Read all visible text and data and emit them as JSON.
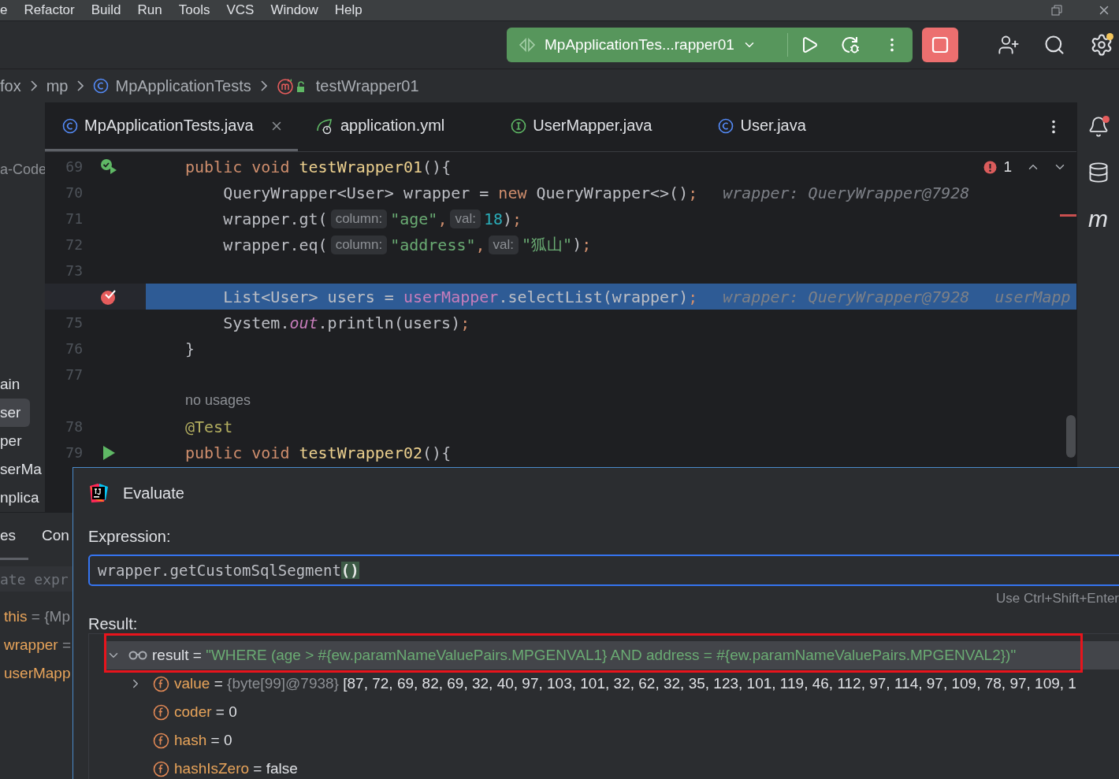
{
  "menu_bar": {
    "items": [
      "e",
      "Refactor",
      "Build",
      "Run",
      "Tools",
      "VCS",
      "Window",
      "Help"
    ]
  },
  "toolbar": {
    "run_configuration": "MpApplicationTes...rapper01"
  },
  "breadcrumbs": [
    {
      "label": "fox",
      "kind": "folder"
    },
    {
      "label": "mp",
      "kind": "folder"
    },
    {
      "label": "MpApplicationTests",
      "kind": "class"
    },
    {
      "label": "testWrapper01",
      "kind": "method"
    }
  ],
  "project_tree": {
    "root_label": "a-Code",
    "items": [
      {
        "label": "ain",
        "selected": false
      },
      {
        "label": "ser",
        "selected": true
      },
      {
        "label": "per",
        "selected": false
      },
      {
        "label": "serMa",
        "selected": false
      },
      {
        "label": "nplica",
        "selected": false
      }
    ]
  },
  "editor_tabs": [
    {
      "label": "MpApplicationTests.java",
      "kind": "class",
      "selected": true
    },
    {
      "label": "application.yml",
      "kind": "yaml",
      "selected": false
    },
    {
      "label": "UserMapper.java",
      "kind": "interface",
      "selected": false
    },
    {
      "label": "User.java",
      "kind": "class",
      "selected": false
    }
  ],
  "problems": {
    "count": "1"
  },
  "editor": {
    "lines": [
      {
        "kind": "code",
        "number": "69",
        "gutter_icon": {
          "kind": "run-passed"
        },
        "current": false,
        "tokens": [
          {
            "kind": "keyword",
            "text": "public void "
          },
          {
            "kind": "method",
            "text": "testWrapper01"
          },
          {
            "kind": "plain",
            "text": "(){"
          }
        ]
      },
      {
        "kind": "code",
        "number": "70",
        "current": false,
        "tokens": [
          {
            "kind": "plain",
            "text": "    QueryWrapper<User> wrapper = "
          },
          {
            "kind": "keyword",
            "text": "new "
          },
          {
            "kind": "plain",
            "text": "QueryWrapper<>()"
          },
          {
            "kind": "punct",
            "text": ";"
          },
          {
            "kind": "debug",
            "text": "wrapper: QueryWrapper@7928"
          }
        ]
      },
      {
        "kind": "code",
        "number": "71",
        "current": false,
        "tokens": [
          {
            "kind": "plain",
            "text": "    wrapper.gt("
          },
          {
            "kind": "hint",
            "text": "column:"
          },
          {
            "kind": "string",
            "text": "\"age\""
          },
          {
            "kind": "punct",
            "text": ","
          },
          {
            "kind": "hint",
            "text": "val:"
          },
          {
            "kind": "number",
            "text": "18"
          },
          {
            "kind": "plain",
            "text": ")"
          },
          {
            "kind": "punct",
            "text": ";"
          }
        ]
      },
      {
        "kind": "code",
        "number": "72",
        "current": false,
        "tokens": [
          {
            "kind": "plain",
            "text": "    wrapper.eq("
          },
          {
            "kind": "hint",
            "text": "column:"
          },
          {
            "kind": "string",
            "text": "\"address\""
          },
          {
            "kind": "punct",
            "text": ","
          },
          {
            "kind": "hint",
            "text": "val:"
          },
          {
            "kind": "string",
            "text": "\"狐山\""
          },
          {
            "kind": "plain",
            "text": ")"
          },
          {
            "kind": "punct",
            "text": ";"
          }
        ]
      },
      {
        "kind": "code",
        "number": "73",
        "current": false
      },
      {
        "kind": "code",
        "gutter_icon": {
          "kind": "breakpoint"
        },
        "current": true,
        "tokens": [
          {
            "kind": "plain",
            "text": "    List<User> users = "
          },
          {
            "kind": "field",
            "text": "userMapper"
          },
          {
            "kind": "plain",
            "text": ".selectList(wrapper)"
          },
          {
            "kind": "punct",
            "text": ";"
          },
          {
            "kind": "debug",
            "text": "wrapper: QueryWrapper@7928"
          },
          {
            "kind": "debug",
            "text": "userMapp"
          }
        ]
      },
      {
        "kind": "code",
        "number": "75",
        "current": false,
        "tokens": [
          {
            "kind": "plain",
            "text": "    System."
          },
          {
            "kind": "static",
            "text": "out"
          },
          {
            "kind": "plain",
            "text": ".println(users)"
          },
          {
            "kind": "punct",
            "text": ";"
          }
        ]
      },
      {
        "kind": "code",
        "number": "76",
        "current": false,
        "tokens": [
          {
            "kind": "plain",
            "text": "}"
          }
        ]
      },
      {
        "kind": "code",
        "number": "77",
        "current": false
      },
      {
        "kind": "usages",
        "text": "no usages"
      },
      {
        "kind": "code",
        "number": "78",
        "current": false,
        "tokens": [
          {
            "kind": "annotation",
            "text": "@Test"
          }
        ]
      },
      {
        "kind": "code",
        "number": "79",
        "gutter_icon": {
          "kind": "run"
        },
        "current": false,
        "tokens": [
          {
            "kind": "keyword",
            "text": "public void "
          },
          {
            "kind": "method",
            "text": "testWrapper02"
          },
          {
            "kind": "plain",
            "text": "(){"
          }
        ]
      }
    ]
  },
  "right_toolbar": {
    "plugin_letter": "m"
  },
  "debug_panel": {
    "tabs": [
      {
        "label": "es",
        "selected": true
      },
      {
        "label": "Con",
        "selected": false
      }
    ],
    "expression_field": {
      "placeholder": "ate expr"
    },
    "variables": [
      {
        "name": "this",
        "value": "= {Mp"
      },
      {
        "name": "wrapper",
        "value": "="
      },
      {
        "name": "userMapp"
      }
    ]
  },
  "evaluate_dialog": {
    "title": "Evaluate",
    "expression_label": "Expression:",
    "expression": [
      {
        "text": "wrapper.getCustomSqlSegment",
        "matched": false
      },
      {
        "text": "()",
        "matched": true
      }
    ],
    "hint": "Use Ctrl+Shift+Enter",
    "result_label": "Result:",
    "result_tree": [
      {
        "kind": "watch",
        "name": "result",
        "op": "=",
        "value": {
          "kind": "string",
          "text": "\"WHERE (age > #{ew.paramNameValuePairs.MPGENVAL1} AND address = #{ew.paramNameValuePairs.MPGENVAL2})\""
        },
        "selected": true,
        "expanded": true,
        "marked": true,
        "children": [
          {
            "kind": "field",
            "name": "value",
            "op": "=",
            "descriptor": "{byte[99]@7938}",
            "value": {
              "kind": "plain",
              "text": "[87, 72, 69, 82, 69, 32, 40, 97, 103, 101, 32, 62, 32, 35, 123, 101, 119, 46, 112, 97, 114, 97, 109, 78, 97, 109, 1"
            },
            "selected": false,
            "expanded": false,
            "marked": false
          },
          {
            "kind": "field",
            "name": "coder",
            "op": "=",
            "value": {
              "kind": "plain",
              "text": "0"
            },
            "selected": false,
            "marked": false
          },
          {
            "kind": "field",
            "name": "hash",
            "op": "=",
            "value": {
              "kind": "plain",
              "text": "0"
            },
            "selected": false,
            "marked": false
          },
          {
            "kind": "field",
            "name": "hashIsZero",
            "op": "=",
            "value": {
              "kind": "plain",
              "text": "false"
            },
            "selected": false,
            "marked": false
          }
        ]
      }
    ]
  }
}
